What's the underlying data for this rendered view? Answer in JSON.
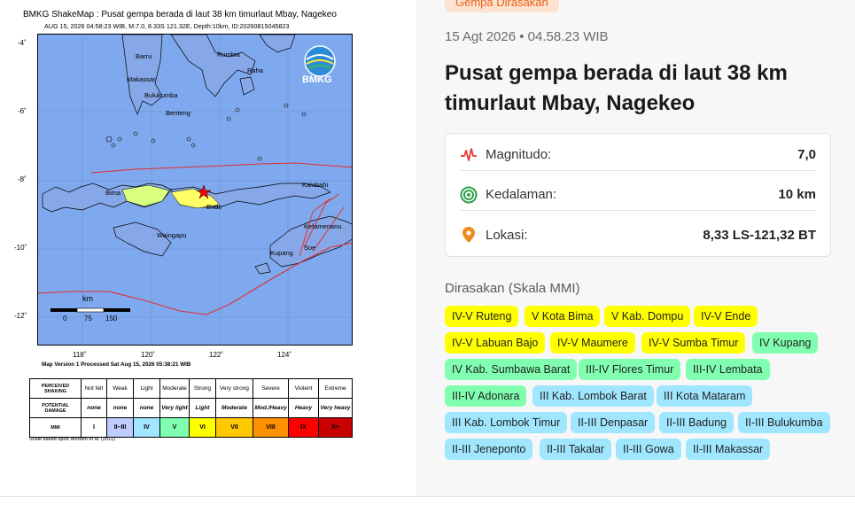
{
  "shakemap": {
    "title": "BMKG ShakeMap : Pusat gempa berada di laut 38 km timurlaut Mbay, Nagekeo",
    "subtitle": "AUG 15, 2026 04:58:23 WIB, M:7.0, 8.33S 121.32E, Depth:10km, ID:20260815045823",
    "logo_text": "BMKG",
    "lat_ticks": [
      "-4˚",
      "-6˚",
      "-8˚",
      "-10˚",
      "-12˚"
    ],
    "lon_ticks": [
      "118˚",
      "120˚",
      "122˚",
      "124˚"
    ],
    "place_labels": [
      "Barru",
      "Makassar",
      "Bulukumba",
      "Benteng",
      "Rumbia",
      "Raha",
      "Bima",
      "Ende",
      "Waingapu",
      "Kalabahi",
      "Kefamenanu",
      "Kupang",
      "Soe"
    ],
    "scale_unit": "km",
    "scale_values": [
      "0",
      "75",
      "150"
    ],
    "map_version": "Map Version 1 Processed Sat Aug 15, 2026 05:38:21 WIB",
    "scale_note": "Scale based upon Worden et al. (2011)",
    "legend": {
      "row1_head": "PERCEIVED SHAKING",
      "row1": [
        "Not felt",
        "Weak",
        "Light",
        "Moderate",
        "Strong",
        "Very strong",
        "Severe",
        "Violent",
        "Extreme"
      ],
      "row2_head": "POTENTIAL DAMAGE",
      "row2": [
        "none",
        "none",
        "none",
        "Very light",
        "Light",
        "Moderate",
        "Mod./Heavy",
        "Heavy",
        "Very heavy"
      ],
      "row3_head": "MMI",
      "row3": [
        "I",
        "II–III",
        "IV",
        "V",
        "VI",
        "VII",
        "VIII",
        "IX",
        "X+"
      ],
      "row3_colors": [
        "#ffffff",
        "#bfccff",
        "#a0e6ff",
        "#80ffb0",
        "#ffff00",
        "#ffc800",
        "#ff9100",
        "#ff0000",
        "#c80000"
      ]
    }
  },
  "event": {
    "badge": "Gempa Dirasakan",
    "datetime": "15 Agt 2026 • 04.58.23 WIB",
    "headline": "Pusat gempa berada di laut 38 km timurlaut Mbay, Nagekeo",
    "details": [
      {
        "icon": "pulse-icon",
        "label": "Magnitudo:",
        "value": "7,0"
      },
      {
        "icon": "target-icon",
        "label": "Kedalaman:",
        "value": "10 km"
      },
      {
        "icon": "location-pin-icon",
        "label": "Lokasi:",
        "value": "8,33 LS-121,32 BT"
      }
    ],
    "felt_title": "Dirasakan (Skala MMI)",
    "felt": [
      {
        "text": "IV-V Ruteng",
        "color": "#ffff00"
      },
      {
        "text": "V Kota Bima",
        "color": "#ffff00"
      },
      {
        "text": "V Kab. Dompu",
        "color": "#ffff00"
      },
      {
        "text": "IV-V Ende",
        "color": "#ffff00"
      },
      {
        "text": "IV-V Labuan Bajo",
        "color": "#ffff00"
      },
      {
        "text": "IV-V Maumere",
        "color": "#ffff00"
      },
      {
        "text": "IV-V Sumba Timur",
        "color": "#ffff00"
      },
      {
        "text": "IV Kupang",
        "color": "#80ffb0"
      },
      {
        "text": "IV Kab. Sumbawa Barat",
        "color": "#80ffb0"
      },
      {
        "text": "III-IV Flores Timur",
        "color": "#80ffb0"
      },
      {
        "text": "III-IV Lembata",
        "color": "#80ffb0"
      },
      {
        "text": "III-IV Adonara",
        "color": "#80ffb0"
      },
      {
        "text": "III Kab. Lombok Barat",
        "color": "#a0e6ff"
      },
      {
        "text": "III Kota Mataram",
        "color": "#a0e6ff"
      },
      {
        "text": "III Kab. Lombok Timur",
        "color": "#a0e6ff"
      },
      {
        "text": "II-III Denpasar",
        "color": "#a0e6ff"
      },
      {
        "text": "II-III Badung",
        "color": "#a0e6ff"
      },
      {
        "text": "II-III Bulukumba",
        "color": "#a0e6ff"
      },
      {
        "text": "II-III Jeneponto",
        "color": "#a0e6ff"
      },
      {
        "text": "II-III Takalar",
        "color": "#a0e6ff"
      },
      {
        "text": "II-III Gowa",
        "color": "#a0e6ff"
      },
      {
        "text": "II-III Makassar",
        "color": "#a0e6ff"
      }
    ]
  }
}
